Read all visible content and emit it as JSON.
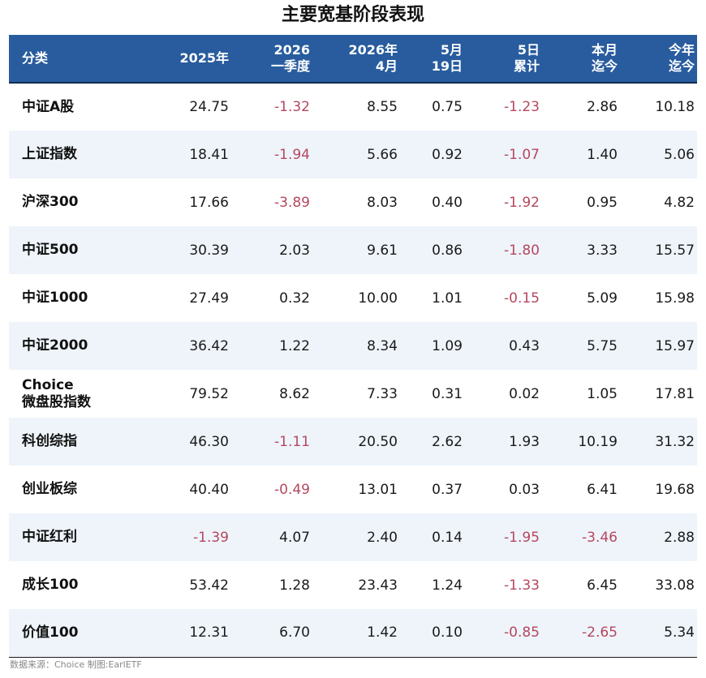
{
  "title": "主要宽基阶段表现",
  "columns": [
    [
      "分类"
    ],
    [
      "2025年"
    ],
    [
      "2026",
      "一季度"
    ],
    [
      "2026年",
      "4月"
    ],
    [
      "5月",
      "19日"
    ],
    [
      "5日",
      "累计"
    ],
    [
      "本月",
      "迄今"
    ],
    [
      "今年",
      "迄今"
    ]
  ],
  "rows": [
    {
      "name": [
        "中证A股"
      ],
      "values": [
        "24.75",
        "-1.32",
        "8.55",
        "0.75",
        "-1.23",
        "2.86",
        "10.18"
      ]
    },
    {
      "name": [
        "上证指数"
      ],
      "values": [
        "18.41",
        "-1.94",
        "5.66",
        "0.92",
        "-1.07",
        "1.40",
        "5.06"
      ]
    },
    {
      "name": [
        "沪深300"
      ],
      "values": [
        "17.66",
        "-3.89",
        "8.03",
        "0.40",
        "-1.92",
        "0.95",
        "4.82"
      ]
    },
    {
      "name": [
        "中证500"
      ],
      "values": [
        "30.39",
        "2.03",
        "9.61",
        "0.86",
        "-1.80",
        "3.33",
        "15.57"
      ]
    },
    {
      "name": [
        "中证1000"
      ],
      "values": [
        "27.49",
        "0.32",
        "10.00",
        "1.01",
        "-0.15",
        "5.09",
        "15.98"
      ]
    },
    {
      "name": [
        "中证2000"
      ],
      "values": [
        "36.42",
        "1.22",
        "8.34",
        "1.09",
        "0.43",
        "5.75",
        "15.97"
      ]
    },
    {
      "name": [
        "Choice",
        "微盘股指数"
      ],
      "values": [
        "79.52",
        "8.62",
        "7.33",
        "0.31",
        "0.02",
        "1.05",
        "17.81"
      ]
    },
    {
      "name": [
        "科创综指"
      ],
      "values": [
        "46.30",
        "-1.11",
        "20.50",
        "2.62",
        "1.93",
        "10.19",
        "31.32"
      ]
    },
    {
      "name": [
        "创业板综"
      ],
      "values": [
        "40.40",
        "-0.49",
        "13.01",
        "0.37",
        "0.03",
        "6.41",
        "19.68"
      ]
    },
    {
      "name": [
        "中证红利"
      ],
      "values": [
        "-1.39",
        "4.07",
        "2.40",
        "0.14",
        "-1.95",
        "-3.46",
        "2.88"
      ]
    },
    {
      "name": [
        "成长100"
      ],
      "values": [
        "53.42",
        "1.28",
        "23.43",
        "1.24",
        "-1.33",
        "6.45",
        "33.08"
      ]
    },
    {
      "name": [
        "价值100"
      ],
      "values": [
        "12.31",
        "6.70",
        "1.42",
        "0.10",
        "-0.85",
        "-2.65",
        "5.34"
      ]
    }
  ],
  "source": "数据来源：Choice 制图:EarlETF",
  "colors": {
    "header_bg": "#285c9e",
    "header_text": "#ffffff",
    "negative": "#b5475f",
    "row_shade": "#eef4fa"
  }
}
